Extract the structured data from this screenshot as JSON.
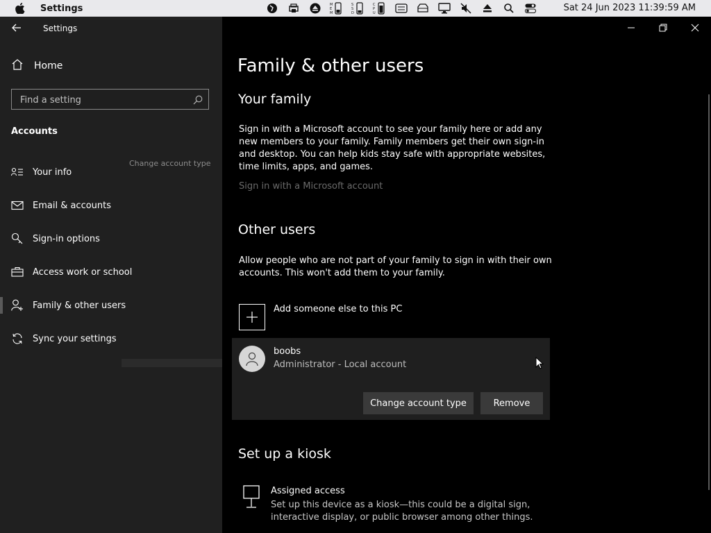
{
  "menubar": {
    "app_name": "Settings",
    "clock": "Sat 24 Jun 2023 11:39:59 AM"
  },
  "window": {
    "title": "Settings"
  },
  "sidebar": {
    "home": "Home",
    "search_placeholder": "Find a setting",
    "section": "Accounts",
    "items": [
      {
        "label": "Your info",
        "icon": "contact-card-icon"
      },
      {
        "label": "Email & accounts",
        "icon": "mail-icon"
      },
      {
        "label": "Sign-in options",
        "icon": "key-icon"
      },
      {
        "label": "Access work or school",
        "icon": "briefcase-icon"
      },
      {
        "label": "Family & other users",
        "icon": "person-add-icon"
      },
      {
        "label": "Sync your settings",
        "icon": "sync-icon"
      }
    ],
    "ghost_text": "Change account type"
  },
  "main": {
    "title": "Family & other users",
    "family": {
      "heading": "Your family",
      "text": "Sign in with a Microsoft account to see your family here or add any new members to your family. Family members get their own sign-in and desktop. You can help kids stay safe with appropriate websites, time limits, apps, and games.",
      "link": "Sign in with a Microsoft account"
    },
    "other": {
      "heading": "Other users",
      "text": "Allow people who are not part of your family to sign in with their own accounts. This won't add them to your family.",
      "add_label": "Add someone else to this PC",
      "user": {
        "name": "boobs",
        "role": "Administrator - Local account"
      },
      "change_button": "Change account type",
      "remove_button": "Remove"
    },
    "kiosk": {
      "heading": "Set up a kiosk",
      "title": "Assigned access",
      "desc": "Set up this device as a kiosk—this could be a digital sign, interactive display, or public browser among other things."
    }
  }
}
